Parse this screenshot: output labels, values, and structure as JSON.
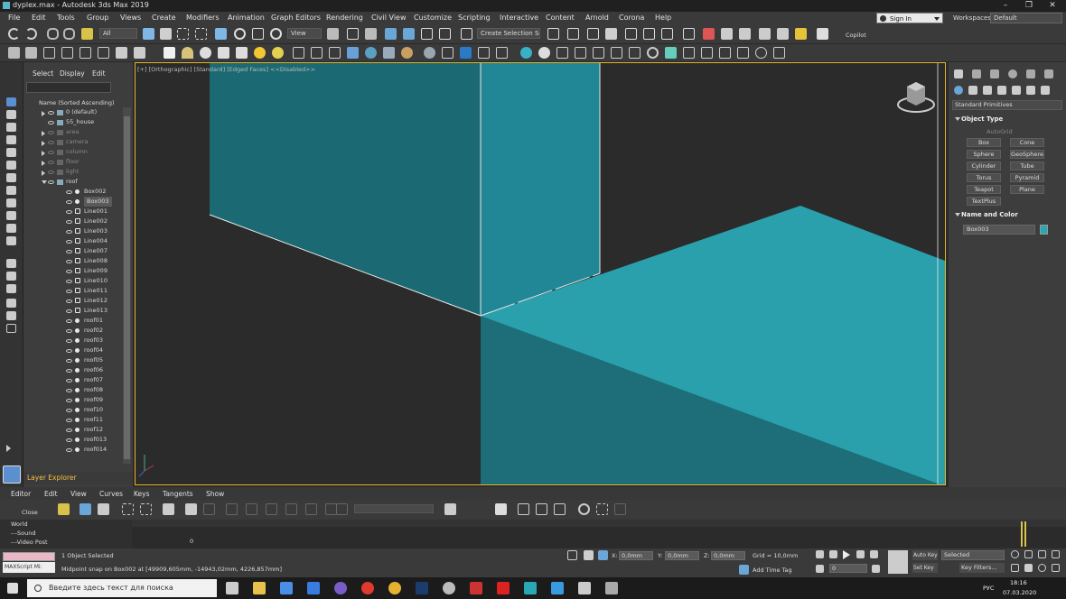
{
  "window": {
    "title": "dyplex.max - Autodesk 3ds Max 2019"
  },
  "menu": [
    "File",
    "Edit",
    "Tools",
    "Group",
    "Views",
    "Create",
    "Modifiers",
    "Animation",
    "Graph Editors",
    "Rendering",
    "Civil View",
    "Customize",
    "Scripting",
    "Interactive",
    "Content",
    "Arnold",
    "Corona",
    "Help"
  ],
  "account": {
    "signin": "Sign In",
    "workspaces_label": "Workspaces:",
    "workspace": "Default"
  },
  "toolbar": {
    "filter": "All",
    "view": "View",
    "selection_set": "Create Selection Se",
    "copilot": "Copilot"
  },
  "scene_explorer": {
    "tabs": [
      "Select",
      "Display",
      "Edit"
    ],
    "sort_header": "Name (Sorted Ascending)",
    "rows": [
      {
        "name": "0 (default)",
        "kind": "layer",
        "indent": 0,
        "expander": "closed"
      },
      {
        "name": "55_house",
        "kind": "layer",
        "indent": 0,
        "expander": "none"
      },
      {
        "name": "area",
        "kind": "layer-hidden",
        "indent": 0,
        "expander": "closed"
      },
      {
        "name": "camera",
        "kind": "layer-hidden",
        "indent": 0,
        "expander": "closed"
      },
      {
        "name": "column",
        "kind": "layer-hidden",
        "indent": 0,
        "expander": "closed"
      },
      {
        "name": "floor",
        "kind": "layer-hidden",
        "indent": 0,
        "expander": "closed"
      },
      {
        "name": "light",
        "kind": "layer-hidden",
        "indent": 0,
        "expander": "closed"
      },
      {
        "name": "roof",
        "kind": "layer",
        "indent": 0,
        "expander": "open"
      },
      {
        "name": "Box002",
        "kind": "object",
        "indent": 1,
        "expander": "none"
      },
      {
        "name": "Box003",
        "kind": "object-selected",
        "indent": 1,
        "expander": "none"
      },
      {
        "name": "Line001",
        "kind": "spline",
        "indent": 1,
        "expander": "none"
      },
      {
        "name": "Line002",
        "kind": "spline",
        "indent": 1,
        "expander": "none"
      },
      {
        "name": "Line003",
        "kind": "spline",
        "indent": 1,
        "expander": "none"
      },
      {
        "name": "Line004",
        "kind": "spline",
        "indent": 1,
        "expander": "none"
      },
      {
        "name": "Line007",
        "kind": "spline",
        "indent": 1,
        "expander": "none"
      },
      {
        "name": "Line008",
        "kind": "spline",
        "indent": 1,
        "expander": "none"
      },
      {
        "name": "Line009",
        "kind": "spline",
        "indent": 1,
        "expander": "none"
      },
      {
        "name": "Line010",
        "kind": "spline",
        "indent": 1,
        "expander": "none"
      },
      {
        "name": "Line011",
        "kind": "spline",
        "indent": 1,
        "expander": "none"
      },
      {
        "name": "Line012",
        "kind": "spline",
        "indent": 1,
        "expander": "none"
      },
      {
        "name": "Line013",
        "kind": "spline",
        "indent": 1,
        "expander": "none"
      },
      {
        "name": "roof01",
        "kind": "object",
        "indent": 1,
        "expander": "none"
      },
      {
        "name": "roof02",
        "kind": "object",
        "indent": 1,
        "expander": "none"
      },
      {
        "name": "roof03",
        "kind": "object",
        "indent": 1,
        "expander": "none"
      },
      {
        "name": "roof04",
        "kind": "object",
        "indent": 1,
        "expander": "none"
      },
      {
        "name": "roof05",
        "kind": "object",
        "indent": 1,
        "expander": "none"
      },
      {
        "name": "roof06",
        "kind": "object",
        "indent": 1,
        "expander": "none"
      },
      {
        "name": "roof07",
        "kind": "object",
        "indent": 1,
        "expander": "none"
      },
      {
        "name": "roof08",
        "kind": "object",
        "indent": 1,
        "expander": "none"
      },
      {
        "name": "roof09",
        "kind": "object",
        "indent": 1,
        "expander": "none"
      },
      {
        "name": "roof10",
        "kind": "object",
        "indent": 1,
        "expander": "none"
      },
      {
        "name": "roof11",
        "kind": "object",
        "indent": 1,
        "expander": "none"
      },
      {
        "name": "roof12",
        "kind": "object",
        "indent": 1,
        "expander": "none"
      },
      {
        "name": "roof013",
        "kind": "object",
        "indent": 1,
        "expander": "none"
      },
      {
        "name": "roof014",
        "kind": "object",
        "indent": 1,
        "expander": "none"
      }
    ],
    "footer": "Layer Explorer"
  },
  "viewport": {
    "label": "[+] [Orthographic] [Standard] [Edged Faces]  <<Disabled>>",
    "object_color": "#2aa7b5"
  },
  "command_panel": {
    "category": "Standard Primitives",
    "object_type_title": "Object Type",
    "autogrid": "AutoGrid",
    "primitives": [
      "Box",
      "Cone",
      "Sphere",
      "GeoSphere",
      "Cylinder",
      "Tube",
      "Torus",
      "Pyramid",
      "Teapot",
      "Plane",
      "TextPlus"
    ],
    "name_color_title": "Name and Color",
    "object_name": "Box003",
    "object_color": "#2aa7b5"
  },
  "bottom": {
    "tabs": [
      "Editor",
      "Edit",
      "View",
      "Curves",
      "Keys",
      "Tangents",
      "Show"
    ],
    "tree": [
      "Close",
      "World",
      "---Sound",
      "---Video Post"
    ],
    "frame": "0"
  },
  "status": {
    "maxscript": "MAXScript Mi:",
    "selection": "1 Object Selected",
    "prompt": "Midpoint snap on Box002 at [49909,605mm, -14943,02mm, 4226,857mm]",
    "x_label": "X:",
    "x": "0,0mm",
    "y_label": "Y:",
    "y": "0,0mm",
    "z_label": "Z:",
    "z": "0,0mm",
    "grid": "Grid = 10,0mm",
    "add_time_tag": "Add Time Tag",
    "auto_key": "Auto Key",
    "set_key": "Set Key",
    "selected": "Selected",
    "key_filters": "Key Filters...",
    "frame_field": "0"
  },
  "taskbar": {
    "search_placeholder": "Введите здесь текст для поиска",
    "lang": "РУС",
    "time": "18:16",
    "date": "07.03.2020"
  }
}
